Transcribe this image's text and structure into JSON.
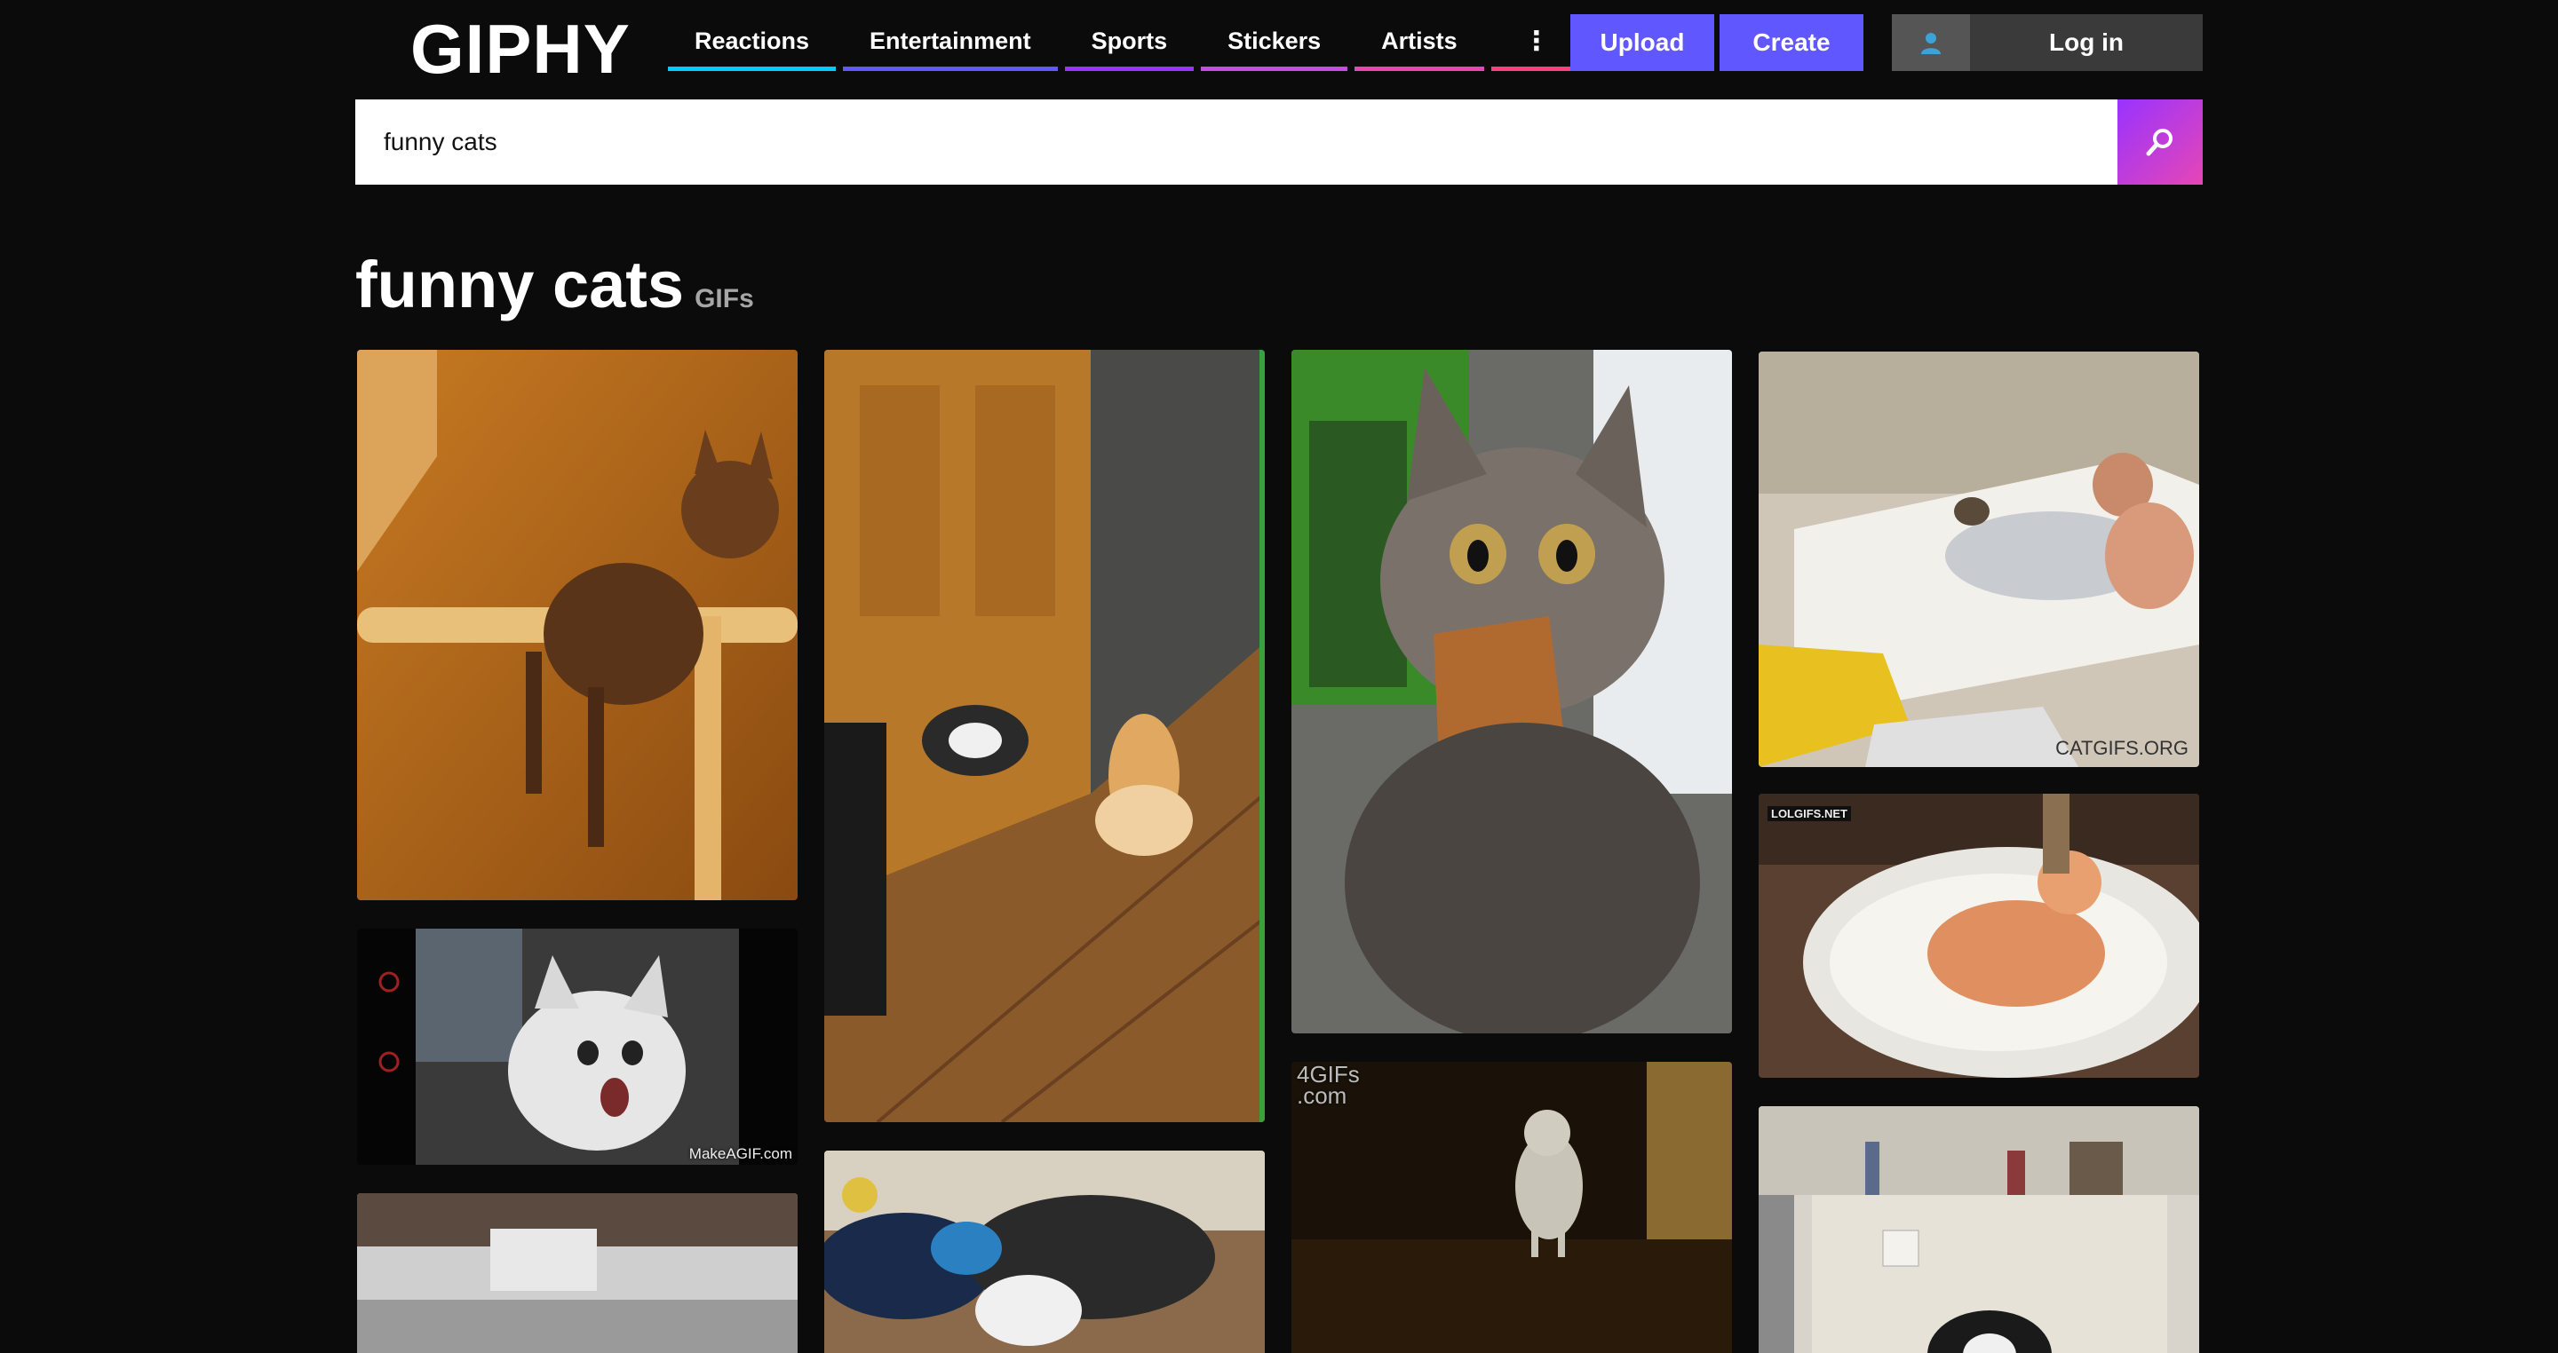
{
  "header": {
    "logo": "GIPHY",
    "nav": [
      {
        "label": "Reactions",
        "color": "#00ccff"
      },
      {
        "label": "Entertainment",
        "color": "#6157ff"
      },
      {
        "label": "Sports",
        "color": "#9933ff"
      },
      {
        "label": "Stickers",
        "color": "#c44ce0"
      },
      {
        "label": "Artists",
        "color": "#e646b6"
      },
      {
        "label": "⋮",
        "color": "#ff3d7f"
      }
    ],
    "upload_label": "Upload",
    "create_label": "Create",
    "login_label": "Log in",
    "accent": "#6157ff"
  },
  "search": {
    "value": "funny cats",
    "icon": "search-icon"
  },
  "results": {
    "title": "funny cats",
    "subtitle": "GIFs",
    "watermarks": {
      "makeagif": "MakeAGIF.com",
      "catgifs": "CATGIFS.ORG",
      "lolgifs": "LOLGIFS.NET",
      "fourgifs": "4GIFs\n.com"
    }
  }
}
